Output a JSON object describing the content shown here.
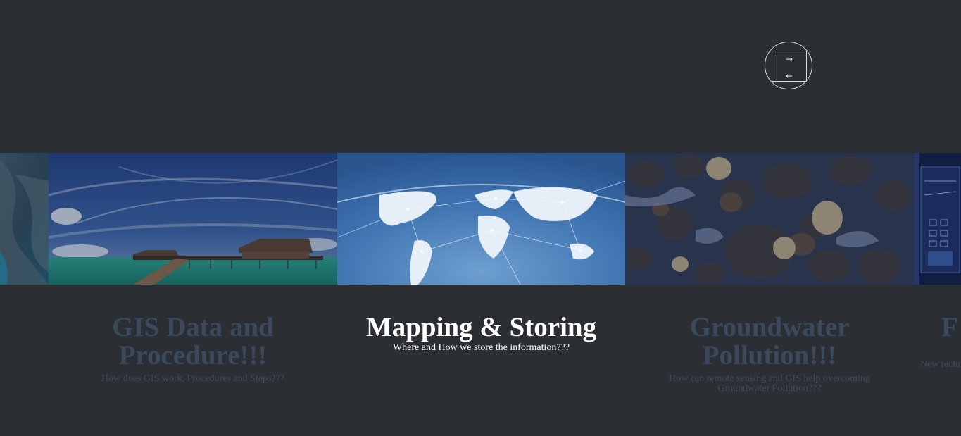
{
  "nav": {
    "next_glyph": "→",
    "prev_glyph": "←"
  },
  "slides": [
    {
      "title": "",
      "subtitle": ""
    },
    {
      "title": "GIS Data and Procedure!!!",
      "subtitle": "How does GIS work, Procedures and Steps???"
    },
    {
      "title": "Mapping & Storing",
      "subtitle": "Where and How we store the information???"
    },
    {
      "title": "Groundwater Pollution!!!",
      "subtitle": "How can remote sensing and GIS help overcoming Groundwater Pollution???"
    },
    {
      "title": "F",
      "subtitle": "New techn"
    }
  ],
  "active_slide": 2,
  "colors": {
    "background": "#2b2f34",
    "caption_inactive": "#3a4a5c",
    "caption_active": "#ffffff"
  }
}
